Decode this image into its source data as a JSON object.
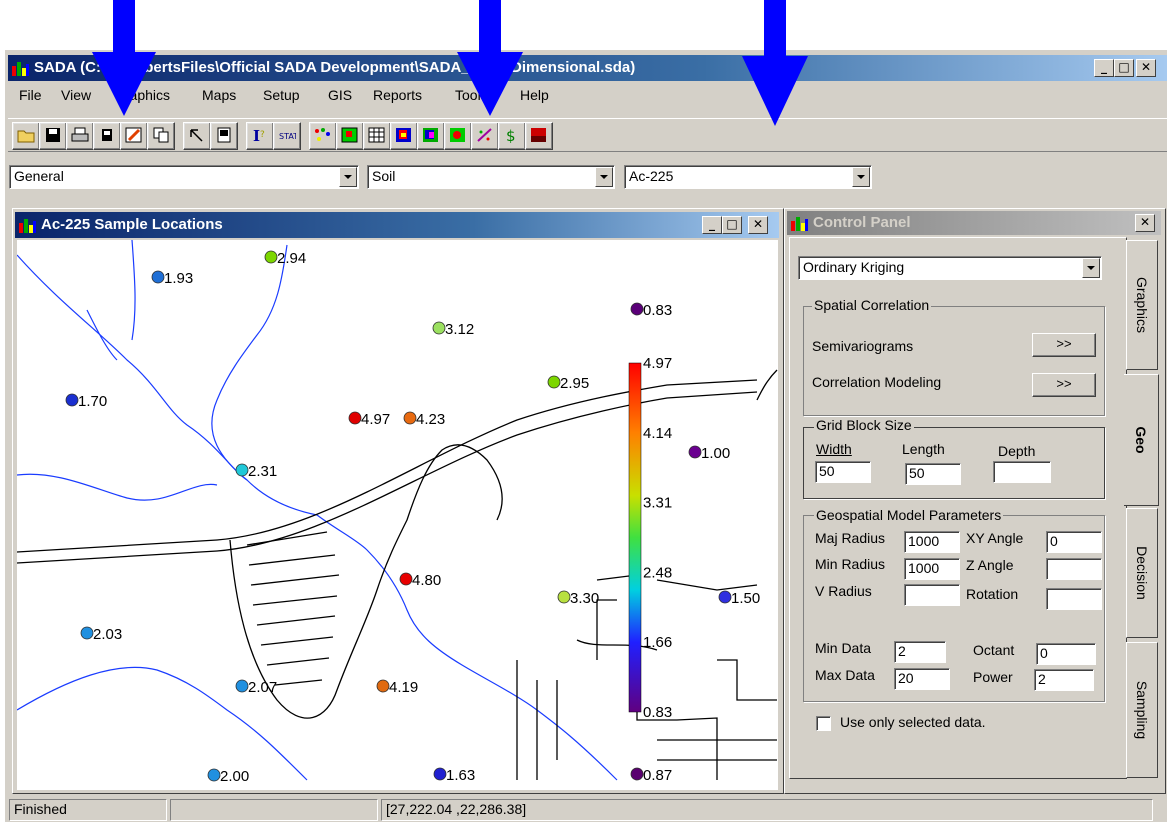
{
  "app": {
    "title": "SADA (C:\\AllRobertsFiles\\Official SADA Development\\SADA_2\\TwoDimensional.sda)"
  },
  "menu": [
    "File",
    "View",
    "Graphics",
    "Maps",
    "Setup",
    "GIS",
    "Reports",
    "Tools",
    "Help"
  ],
  "toolbar_icons": [
    "open-icon",
    "save-icon",
    "print-icon",
    "chip-icon",
    "edit-icon",
    "copy-icon",
    "pointer-icon",
    "window-icon",
    "info-icon",
    "stat-icon",
    "scatter-icon",
    "grid-overlay-icon",
    "table-icon",
    "map-color-icon",
    "map-shade-icon",
    "map-point-icon",
    "draw-icon",
    "cost-icon",
    "layer-icon"
  ],
  "selectors": {
    "scenario": "General",
    "medium": "Soil",
    "contaminant": "Ac-225"
  },
  "map_window": {
    "title": "Ac-225 Sample Locations"
  },
  "samples": [
    {
      "label": "2.94",
      "color": "#7cd600"
    },
    {
      "label": "1.93",
      "color": "#1f6fd6"
    },
    {
      "label": "0.83",
      "color": "#5a0078"
    },
    {
      "label": "3.12",
      "color": "#9be060"
    },
    {
      "label": "2.95",
      "color": "#7cd600"
    },
    {
      "label": "1.70",
      "color": "#1a2fd0"
    },
    {
      "label": "4.97",
      "color": "#e00000"
    },
    {
      "label": "4.23",
      "color": "#e86a10"
    },
    {
      "label": "1.00",
      "color": "#6a0090"
    },
    {
      "label": "2.31",
      "color": "#20c8d8"
    },
    {
      "label": "4.80",
      "color": "#e80000"
    },
    {
      "label": "3.30",
      "color": "#b8e040"
    },
    {
      "label": "1.50",
      "color": "#3030e0"
    },
    {
      "label": "2.03",
      "color": "#2090e0"
    },
    {
      "label": "2.07",
      "color": "#2090e0"
    },
    {
      "label": "4.19",
      "color": "#e06a10"
    },
    {
      "label": "2.00",
      "color": "#2090e0"
    },
    {
      "label": "1.63",
      "color": "#2020d0"
    },
    {
      "label": "0.87",
      "color": "#5a0070"
    }
  ],
  "legend": {
    "ticks": [
      "4.97",
      "4.14",
      "3.31",
      "2.48",
      "1.66",
      "0.83"
    ]
  },
  "control_panel": {
    "title": "Control Panel",
    "method": "Ordinary Kriging",
    "spatial_correlation": {
      "label": "Spatial Correlation",
      "semivariograms": "Semivariograms",
      "correlation_modeling": "Correlation Modeling",
      "btn": ">>"
    },
    "grid_block": {
      "label": "Grid Block Size",
      "width_label": "Width",
      "length_label": "Length",
      "depth_label": "Depth",
      "width": "50",
      "length": "50",
      "depth": ""
    },
    "geo_params": {
      "label": "Geospatial Model Parameters",
      "maj_radius_label": "Maj Radius",
      "maj_radius": "1000",
      "xy_angle_label": "XY Angle",
      "xy_angle": "0",
      "min_radius_label": "Min Radius",
      "min_radius": "1000",
      "z_angle_label": "Z Angle",
      "z_angle": "",
      "v_radius_label": "V Radius",
      "v_radius": "",
      "rotation_label": "Rotation",
      "rotation": "",
      "min_data_label": "Min Data",
      "min_data": "2",
      "octant_label": "Octant",
      "octant": "0",
      "max_data_label": "Max Data",
      "max_data": "20",
      "power_label": "Power",
      "power": "2"
    },
    "use_selected": "Use only selected data.",
    "tabs": [
      "Graphics",
      "Geo",
      "Decision",
      "Sampling"
    ]
  },
  "status": {
    "text": "Finished",
    "coords": "[27,222.04 ,22,286.38]"
  },
  "colors": {
    "annotation_arrow": "#0000ff",
    "title_start": "#0a246a",
    "face": "#d4d0c8"
  }
}
